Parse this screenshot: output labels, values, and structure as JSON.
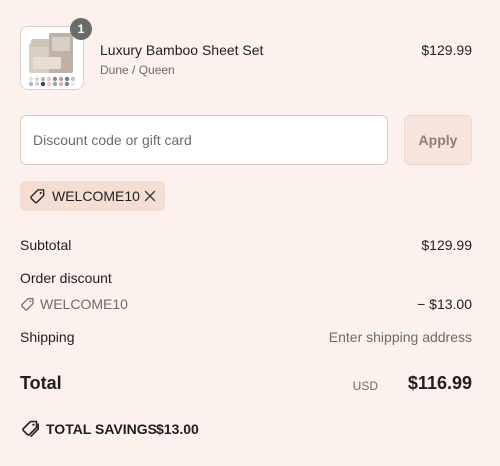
{
  "product": {
    "name": "Luxury Bamboo Sheet Set",
    "variant": "Dune / Queen",
    "price": "$129.99",
    "quantity": "1",
    "image_icon": "folded-sheets-photo"
  },
  "discount": {
    "placeholder": "Discount code or gift card",
    "value": "",
    "apply_label": "Apply",
    "applied_code": "WELCOME10"
  },
  "summary": {
    "subtotal_label": "Subtotal",
    "subtotal_value": "$129.99",
    "order_discount_label": "Order discount",
    "discount_code": "WELCOME10",
    "discount_value": "− $13.00",
    "shipping_label": "Shipping",
    "shipping_value": "Enter shipping address",
    "total_label": "Total",
    "currency": "USD",
    "total_value": "$116.99",
    "savings_label": "TOTAL SAVINGS",
    "savings_value": "$13.00"
  },
  "colors": {
    "background": "#fcf1ec",
    "chip": "#f6ddd2",
    "badge": "#6b6b6b"
  }
}
